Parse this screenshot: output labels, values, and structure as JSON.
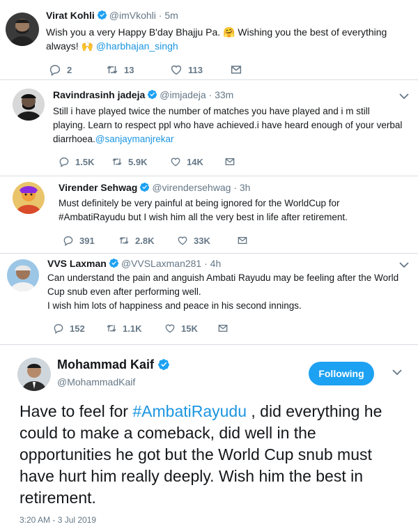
{
  "tweets": [
    {
      "name": "Virat Kohli",
      "handle": "@imVkohli",
      "time": "· 5m",
      "text_main": "Wish you a very Happy B'day Bhajju Pa. 🤗 Wishing you the best of everything always! 🙌",
      "mention": "@harbhajan_singh",
      "replies": "2",
      "retweets": "13",
      "likes": "113"
    },
    {
      "name": "Ravindrasinh jadeja",
      "handle": "@imjadeja",
      "time": "· 33m",
      "text_main": "Still i have played twice the number of matches you have played and i m still playing. Learn to respect ppl who have achieved.i have heard enough of your verbal diarrhoea.",
      "mention": "@sanjaymanjrekar",
      "replies": "1.5K",
      "retweets": "5.9K",
      "likes": "14K"
    },
    {
      "name": "Virender Sehwag",
      "handle": "@virendersehwag",
      "time": "· 3h",
      "text_main": "Must definitely be very painful at being ignored for the WorldCup for #AmbatiRayudu but I wish him all the very best in life after retirement.",
      "mention": "",
      "replies": "391",
      "retweets": "2.8K",
      "likes": "33K"
    },
    {
      "name": "VVS Laxman",
      "handle": "@VVSLaxman281",
      "time": "· 4h",
      "text_main": "Can understand the pain and anguish Ambati Rayudu may be feeling after the World Cup snub even after performing well.",
      "text_second": "I wish him lots of happiness and peace in his second innings.",
      "mention": "",
      "replies": "152",
      "retweets": "1.1K",
      "likes": "15K"
    }
  ],
  "featured": {
    "name": "Mohammad Kaif",
    "handle": "@MohammadKaif",
    "follow_label": "Following",
    "hashtag": "#AmbatiRayudu",
    "text_before": "Have to feel for ",
    "text_after": " , did everything he could to make a comeback, did well in the opportunities he got but the World Cup snub must have hurt him really deeply. Wish him the best in retirement.",
    "timestamp": "3:20 AM - 3 Jul 2019"
  },
  "colors": {
    "link": "#1b95e0",
    "verified": "#1da1f2",
    "meta": "#657786",
    "follow_button": "#1da1f2"
  },
  "icons": [
    "reply-icon",
    "retweet-icon",
    "like-icon",
    "dm-icon",
    "verified-icon",
    "caret-down-icon"
  ]
}
